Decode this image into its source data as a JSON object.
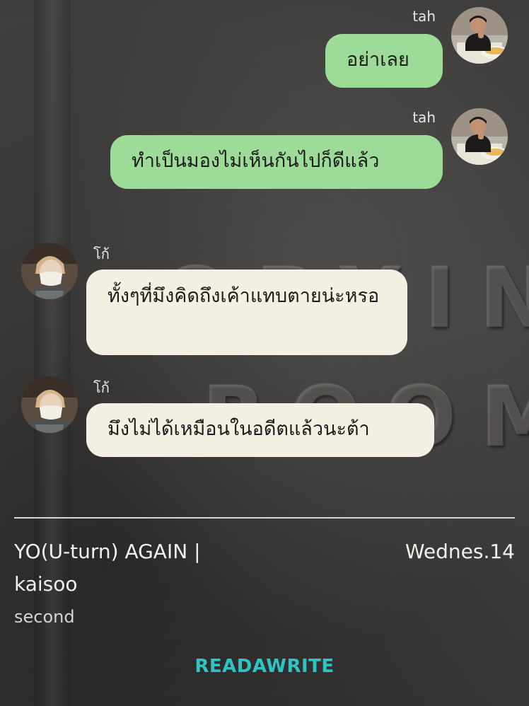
{
  "messages": [
    {
      "sender": "tah",
      "text": "อย่าเลย",
      "side": "right",
      "bubble_color": "#9ddc98"
    },
    {
      "sender": "tah",
      "text": "ทำเป็นมองไม่เห็นกันไปก็ดีแล้ว",
      "side": "right",
      "bubble_color": "#9ddc98"
    },
    {
      "sender": "โก้",
      "text": "ทั้งๆที่มึงคิดถึงเค้าแทบตายน่ะหรอ",
      "side": "left",
      "bubble_color": "#f4efe3"
    },
    {
      "sender": "โก้",
      "text": "มึงไม่ได้เหมือนในอดีตแล้วนะต้า",
      "side": "left",
      "bubble_color": "#f4efe3"
    }
  ],
  "footer": {
    "title": "YO(U-turn) AGAIN | kaisoo",
    "date": "Wednes.14",
    "subtitle": "second",
    "logo": "READAWRITE",
    "logo_color": "#2ec4c4"
  },
  "colors": {
    "background": "#3a3838",
    "divider": "#d8d6d2"
  }
}
